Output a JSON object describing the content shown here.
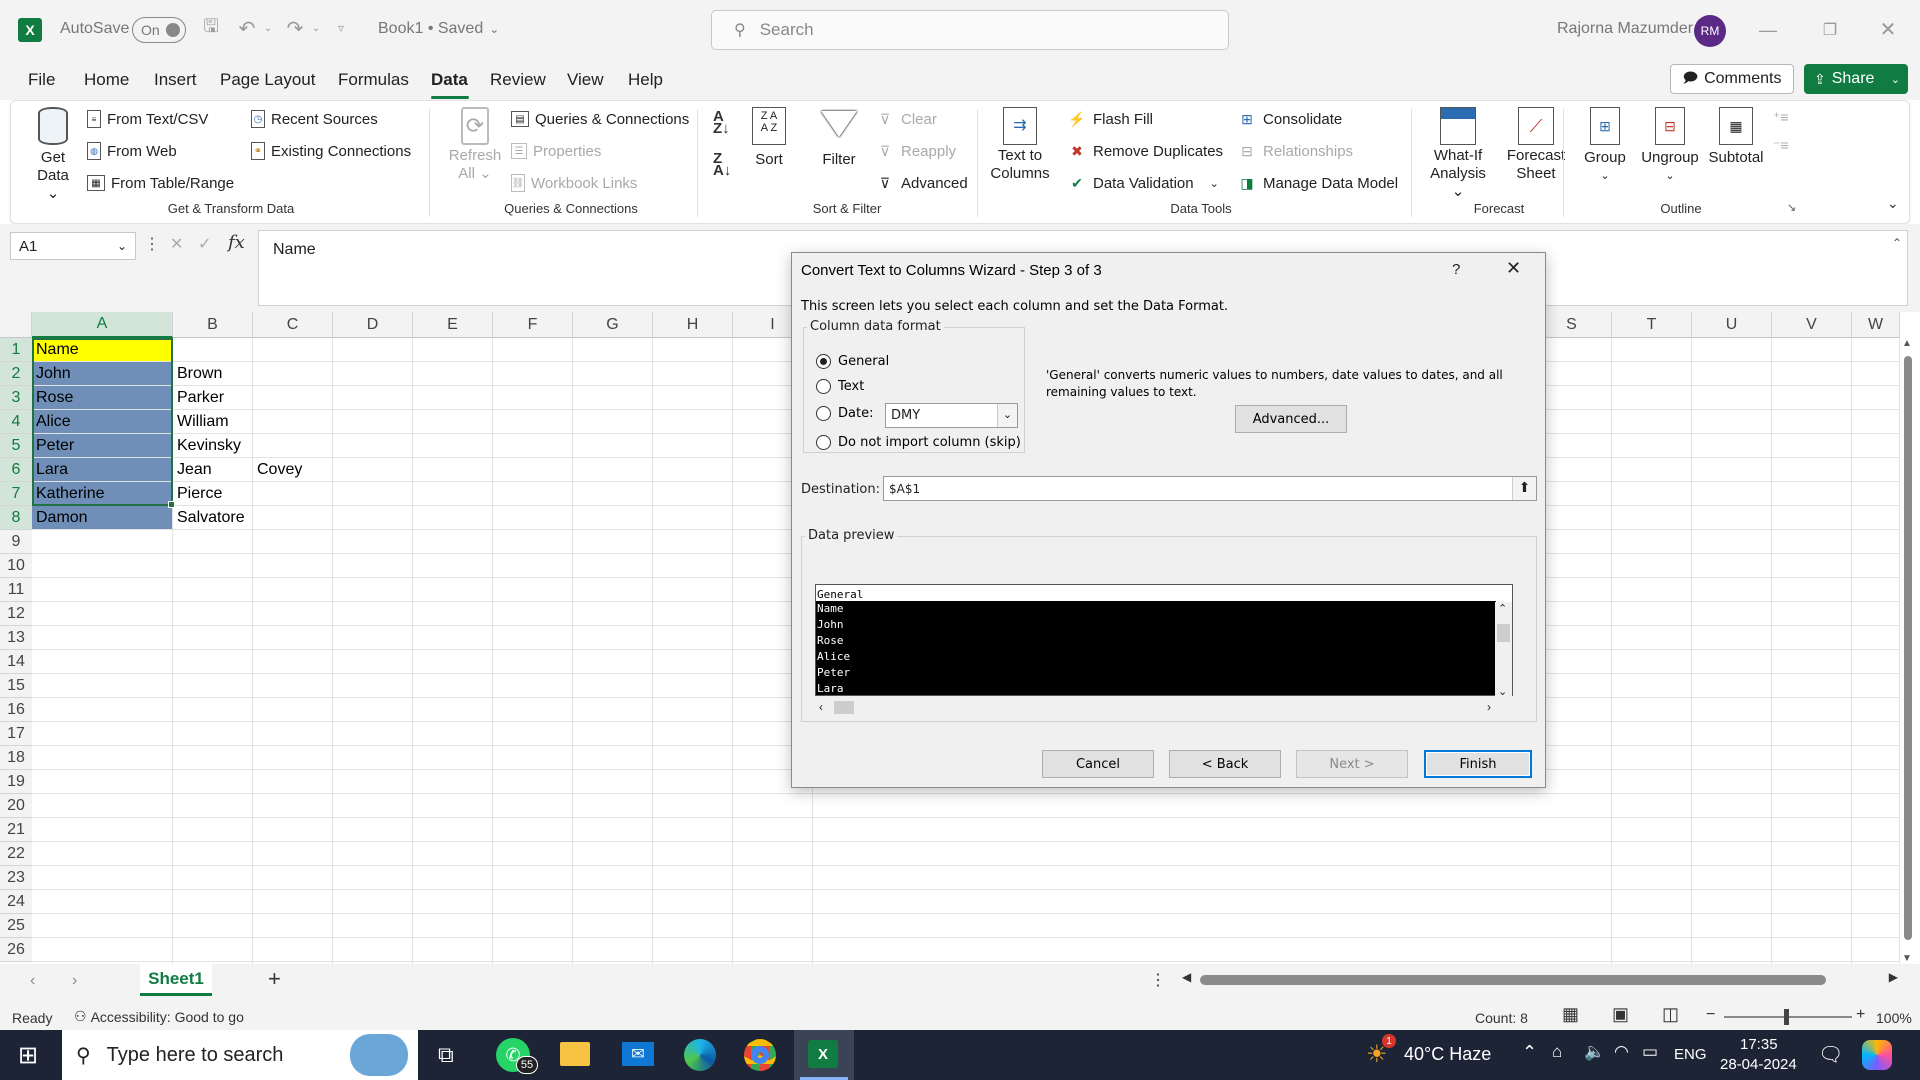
{
  "titlebar": {
    "autosave_label": "AutoSave",
    "autosave_state": "On",
    "doc_title": "Book1 • Saved",
    "search_placeholder": "Search",
    "user_name": "Rajorna Mazumder",
    "user_initials": "RM"
  },
  "menu": {
    "items": [
      "File",
      "Home",
      "Insert",
      "Page Layout",
      "Formulas",
      "Data",
      "Review",
      "View",
      "Help"
    ],
    "active": "Data",
    "comments_label": "Comments",
    "share_label": "Share"
  },
  "ribbon": {
    "get_data": {
      "label1": "Get",
      "label2": "Data"
    },
    "from_text_csv": "From Text/CSV",
    "from_web": "From Web",
    "from_table_range": "From Table/Range",
    "recent_sources": "Recent Sources",
    "existing_connections": "Existing Connections",
    "group_get_transform": "Get & Transform Data",
    "refresh_all": {
      "label1": "Refresh",
      "label2": "All"
    },
    "queries_connections": "Queries & Connections",
    "properties": "Properties",
    "workbook_links": "Workbook Links",
    "group_queries": "Queries & Connections",
    "sort": "Sort",
    "filter": "Filter",
    "clear": "Clear",
    "reapply": "Reapply",
    "advanced": "Advanced",
    "group_sort_filter": "Sort & Filter",
    "text_to_columns": {
      "label1": "Text to",
      "label2": "Columns"
    },
    "flash_fill": "Flash Fill",
    "remove_duplicates": "Remove Duplicates",
    "data_validation": "Data Validation",
    "consolidate": "Consolidate",
    "relationships": "Relationships",
    "manage_data_model": "Manage Data Model",
    "group_data_tools": "Data Tools",
    "what_if": {
      "label1": "What-If",
      "label2": "Analysis"
    },
    "forecast_sheet": {
      "label1": "Forecast",
      "label2": "Sheet"
    },
    "group_forecast": "Forecast",
    "group": "Group",
    "ungroup": "Ungroup",
    "subtotal": "Subtotal",
    "group_outline": "Outline"
  },
  "formula_bar": {
    "name_box": "A1",
    "fx": "fx",
    "content": "Name"
  },
  "grid": {
    "columns": [
      "A",
      "B",
      "C",
      "D",
      "E",
      "F",
      "G",
      "H",
      "I",
      "S",
      "T",
      "U",
      "V",
      "W"
    ],
    "rows": [
      "1",
      "2",
      "3",
      "4",
      "5",
      "6",
      "7",
      "8",
      "9",
      "10",
      "11",
      "12",
      "13",
      "14",
      "15",
      "16",
      "17",
      "18",
      "19",
      "20",
      "21",
      "22",
      "23",
      "24",
      "25",
      "26"
    ],
    "col_a": [
      "Name",
      "John",
      "Rose",
      "Alice",
      "Peter",
      "Lara",
      "Katherine",
      "Damon"
    ],
    "col_b": [
      "",
      "Brown",
      "Parker",
      "William",
      "Kevinsky",
      "Jean",
      "Pierce",
      "Salvatore"
    ],
    "col_c": [
      "",
      "",
      "",
      "",
      "",
      "Covey",
      "",
      ""
    ],
    "colors": {
      "header_fill": "#ffff00",
      "selection_fill": "#6f8fb8",
      "selection_border": "#217346"
    }
  },
  "dialog": {
    "title": "Convert Text to Columns Wizard - Step 3 of 3",
    "help": "?",
    "intro": "This screen lets you select each column and set the Data Format.",
    "format_group": "Column data format",
    "opt_general": "General",
    "opt_text": "Text",
    "opt_date": "Date:",
    "date_value": "DMY",
    "opt_skip": "Do not import column (skip)",
    "description": "'General' converts numeric values to numbers, date values to dates, and all remaining values to text.",
    "advanced_btn": "Advanced...",
    "destination_label": "Destination:",
    "destination_value": "$A$1",
    "preview_label": "Data preview",
    "preview_header": "General",
    "preview_rows": [
      "Name",
      "John",
      "Rose",
      "Alice",
      "Peter",
      "Lara"
    ],
    "cancel": "Cancel",
    "back": "< Back",
    "next": "Next >",
    "finish": "Finish"
  },
  "sheet_tabs": {
    "active": "Sheet1",
    "add": "+"
  },
  "status": {
    "ready": "Ready",
    "accessibility": "Accessibility: Good to go",
    "count": "Count: 8",
    "zoom": "100%"
  },
  "taskbar": {
    "search_placeholder": "Type here to search",
    "whatsapp_badge": "55",
    "weather": "40°C Haze",
    "weather_badge": "1",
    "lang": "ENG",
    "time": "17:35",
    "date": "28-04-2024"
  }
}
